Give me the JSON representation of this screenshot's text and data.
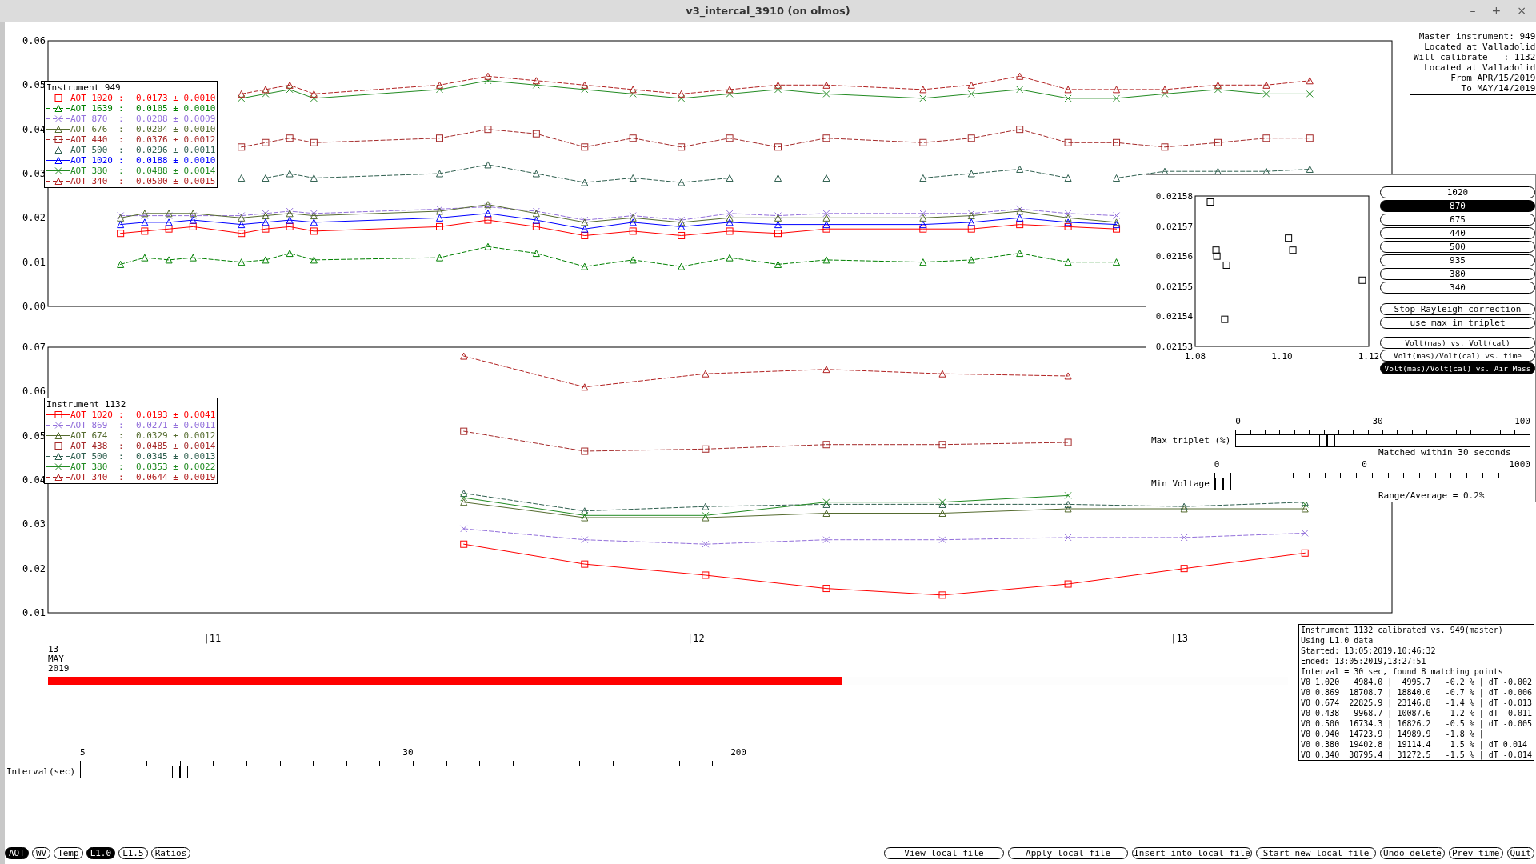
{
  "window": {
    "title": "v3_intercal_3910 (on olmos)",
    "controls": [
      "–",
      "+",
      "×"
    ]
  },
  "master_info": [
    "Master instrument: 949",
    "Located at Valladolid",
    "Will calibrate   : 1132",
    "Located at Valladolid",
    "From APR/15/2019",
    "To MAY/14/2019"
  ],
  "plots": [
    {
      "legend_title": "Instrument 949",
      "legend": [
        {
          "sep": ":",
          "value": "0.0173 ± 0.0010"
        },
        {
          "sep": ":",
          "value": "0.0105 ± 0.0010"
        },
        {
          "sep": ":",
          "value": "0.0208 ± 0.0009"
        },
        {
          "sep": ":",
          "value": "0.0204 ± 0.0010"
        },
        {
          "sep": ":",
          "value": "0.0376 ± 0.0012"
        },
        {
          "sep": ":",
          "value": "0.0296 ± 0.0011"
        },
        {
          "sep": ":",
          "value": "0.0188 ± 0.0010"
        },
        {
          "sep": ":",
          "value": "0.0488 ± 0.0014"
        },
        {
          "sep": ":",
          "value": "0.0500 ± 0.0015"
        }
      ],
      "chart_data": {
        "type": "line",
        "xlim": [
          10.66,
          13.44
        ],
        "ylim": [
          0,
          0.06
        ],
        "yticks": [
          {
            "value": 0,
            "label": "0.00"
          },
          {
            "value": 0.01,
            "label": "0.01"
          },
          {
            "value": 0.02,
            "label": "0.02"
          },
          {
            "value": 0.03,
            "label": "0.03"
          },
          {
            "value": 0.04,
            "label": "0.04"
          },
          {
            "value": 0.05,
            "label": "0.05"
          },
          {
            "value": 0.06,
            "label": "0.06"
          }
        ],
        "x": [
          10.81,
          10.86,
          10.91,
          10.96,
          11.06,
          11.11,
          11.16,
          11.21,
          11.47,
          11.57,
          11.67,
          11.77,
          11.87,
          11.97,
          12.07,
          12.17,
          12.27,
          12.47,
          12.57,
          12.67,
          12.77,
          12.87,
          12.97,
          13.08,
          13.18,
          13.27
        ],
        "series": [
          {
            "name": "AOT 1020",
            "color": "#ff0000",
            "line_style": "solid",
            "marker": "square",
            "values": [
              0.0165,
              0.017,
              0.0175,
              0.018,
              0.0165,
              0.0175,
              0.018,
              0.017,
              0.018,
              0.0195,
              0.018,
              0.016,
              0.017,
              0.016,
              0.017,
              0.0165,
              0.0175,
              0.0175,
              0.0175,
              0.0185,
              0.018,
              0.0175,
              null,
              null,
              null,
              null
            ]
          },
          {
            "name": "AOT 1639",
            "color": "#008000",
            "line_style": "dashed",
            "marker": "triangle",
            "values": [
              0.0095,
              0.011,
              0.0105,
              0.011,
              0.01,
              0.0105,
              0.012,
              0.0105,
              0.011,
              0.0135,
              0.012,
              0.009,
              0.0105,
              0.009,
              0.011,
              0.0095,
              0.0105,
              0.01,
              0.0105,
              0.012,
              0.01,
              0.01,
              null,
              null,
              null,
              null
            ]
          },
          {
            "name": "AOT 870",
            "color": "#9370db",
            "line_style": "dashed",
            "marker": "cross",
            "values": [
              0.0205,
              0.0205,
              0.0205,
              0.0205,
              0.0205,
              0.021,
              0.0215,
              0.021,
              0.022,
              0.0225,
              0.0215,
              0.0195,
              0.0205,
              0.0195,
              0.021,
              0.0205,
              0.021,
              0.021,
              0.021,
              0.022,
              0.021,
              0.0205,
              null,
              null,
              null,
              null
            ]
          },
          {
            "name": "AOT 676",
            "color": "#556b2f",
            "line_style": "solid",
            "marker": "triangle",
            "values": [
              0.02,
              0.021,
              0.021,
              0.021,
              0.02,
              0.0205,
              0.021,
              0.0205,
              0.0215,
              0.023,
              0.021,
              0.019,
              0.02,
              0.019,
              0.02,
              0.02,
              0.02,
              0.02,
              0.0205,
              0.0215,
              0.02,
              0.019,
              null,
              null,
              null,
              null
            ]
          },
          {
            "name": "AOT 440",
            "color": "#a52a2a",
            "line_style": "dashed",
            "marker": "square",
            "values": [
              null,
              null,
              null,
              null,
              0.036,
              0.037,
              0.038,
              0.037,
              0.038,
              0.04,
              0.039,
              0.036,
              0.038,
              0.036,
              0.038,
              0.036,
              0.038,
              0.037,
              0.038,
              0.04,
              0.037,
              0.037,
              0.036,
              0.037,
              0.038,
              0.038
            ]
          },
          {
            "name": "AOT 500",
            "color": "#2f5f4f",
            "line_style": "dashed",
            "marker": "triangle",
            "values": [
              null,
              null,
              null,
              null,
              0.029,
              0.029,
              0.03,
              0.029,
              0.03,
              0.032,
              0.03,
              0.028,
              0.029,
              0.028,
              0.029,
              0.029,
              0.029,
              0.029,
              0.03,
              0.031,
              0.029,
              0.029,
              0.0305,
              0.0305,
              0.0305,
              0.031
            ]
          },
          {
            "name": "AOT 1020",
            "color": "#0000ff",
            "line_style": "solid",
            "marker": "triangle",
            "values": [
              0.0185,
              0.019,
              0.019,
              0.0195,
              0.0185,
              0.019,
              0.0195,
              0.019,
              0.02,
              0.021,
              0.0195,
              0.0175,
              0.019,
              0.018,
              0.019,
              0.0185,
              0.0185,
              0.0185,
              0.019,
              0.02,
              0.019,
              0.0185,
              null,
              null,
              null,
              null
            ]
          },
          {
            "name": "AOT 380",
            "color": "#228b22",
            "line_style": "solid",
            "marker": "cross",
            "values": [
              null,
              null,
              null,
              null,
              0.047,
              0.048,
              0.049,
              0.047,
              0.049,
              0.051,
              0.05,
              0.049,
              0.048,
              0.047,
              0.048,
              0.049,
              0.048,
              0.047,
              0.048,
              0.049,
              0.047,
              0.047,
              0.048,
              0.049,
              0.048,
              0.048
            ]
          },
          {
            "name": "AOT 340",
            "color": "#b22222",
            "line_style": "dashed",
            "marker": "triangle",
            "values": [
              null,
              null,
              null,
              null,
              0.048,
              0.049,
              0.05,
              0.048,
              0.05,
              0.052,
              0.051,
              0.05,
              0.049,
              0.048,
              0.049,
              0.05,
              0.05,
              0.049,
              0.05,
              0.052,
              0.049,
              0.049,
              0.049,
              0.05,
              0.05,
              0.051
            ]
          }
        ]
      }
    },
    {
      "legend_title": "Instrument 1132",
      "legend": [
        {
          "sep": ":",
          "value": "0.0193 ± 0.0041"
        },
        {
          "sep": ":",
          "value": "0.0271 ± 0.0011"
        },
        {
          "sep": ":",
          "value": "0.0329 ± 0.0012"
        },
        {
          "sep": ":",
          "value": "0.0485 ± 0.0014"
        },
        {
          "sep": ":",
          "value": "0.0345 ± 0.0013"
        },
        {
          "sep": ":",
          "value": "0.0353 ± 0.0022"
        },
        {
          "sep": ":",
          "value": "0.0644 ± 0.0019"
        }
      ],
      "chart_data": {
        "type": "line",
        "xlim": [
          10.66,
          13.44
        ],
        "ylim": [
          0.01,
          0.07
        ],
        "xticks": [
          {
            "value": 11,
            "label": "|11"
          },
          {
            "value": 12,
            "label": "|12"
          },
          {
            "value": 13,
            "label": "|13"
          }
        ],
        "yticks": [
          {
            "value": 0.01,
            "label": "0.01"
          },
          {
            "value": 0.02,
            "label": "0.02"
          },
          {
            "value": 0.03,
            "label": "0.03"
          },
          {
            "value": 0.04,
            "label": "0.04"
          },
          {
            "value": 0.05,
            "label": "0.05"
          },
          {
            "value": 0.06,
            "label": "0.06"
          },
          {
            "value": 0.07,
            "label": "0.07"
          }
        ],
        "x": [
          11.52,
          11.77,
          12.02,
          12.27,
          12.51,
          12.77,
          13.01,
          13.26
        ],
        "series": [
          {
            "name": "AOT 1020",
            "color": "#ff0000",
            "line_style": "solid",
            "marker": "square",
            "values": [
              0.0255,
              0.021,
              0.0185,
              0.0155,
              0.014,
              0.0165,
              0.02,
              0.0235
            ]
          },
          {
            "name": "AOT 869",
            "color": "#9370db",
            "line_style": "dashed",
            "marker": "cross",
            "values": [
              0.029,
              0.0265,
              0.0255,
              0.0265,
              0.0265,
              0.027,
              0.027,
              0.028
            ]
          },
          {
            "name": "AOT 674",
            "color": "#556b2f",
            "line_style": "solid",
            "marker": "triangle",
            "values": [
              0.035,
              0.0315,
              0.0315,
              0.0325,
              0.0325,
              0.0335,
              0.0335,
              0.0335
            ]
          },
          {
            "name": "AOT 438",
            "color": "#a52a2a",
            "line_style": "dashed",
            "marker": "square",
            "values": [
              0.051,
              0.0465,
              0.047,
              0.048,
              0.048,
              0.0485,
              null,
              null
            ]
          },
          {
            "name": "AOT 500",
            "color": "#2f5f4f",
            "line_style": "dashed",
            "marker": "triangle",
            "values": [
              0.037,
              0.033,
              0.034,
              0.0345,
              0.0345,
              0.0345,
              0.034,
              0.035
            ]
          },
          {
            "name": "AOT 380",
            "color": "#228b22",
            "line_style": "solid",
            "marker": "cross",
            "values": [
              0.036,
              0.032,
              0.032,
              0.035,
              0.035,
              0.0365,
              null,
              0.0345
            ]
          },
          {
            "name": "AOT 340",
            "color": "#b22222",
            "line_style": "dashed",
            "marker": "triangle",
            "values": [
              0.068,
              0.061,
              0.064,
              0.065,
              0.064,
              0.0635,
              null,
              null
            ]
          }
        ]
      }
    }
  ],
  "date_label": [
    "13",
    "MAY",
    "2019"
  ],
  "progress": {
    "level": 0.64
  },
  "interval_slider": {
    "label": "Interval(sec)",
    "ticks": [
      "5",
      "30",
      "200"
    ],
    "level": 0.14
  },
  "results": [
    "Instrument 1132 calibrated vs. 949(master)",
    "Using L1.0 data",
    "Started: 13:05:2019,10:46:32",
    "Ended: 13:05:2019,13:27:51",
    "Interval = 30 sec, found 8 matching points",
    "V0 1.020   4984.0 |  4995.7 | -0.2 % | dT -0.002",
    "V0 0.869  18708.7 | 18840.0 | -0.7 % | dT -0.006",
    "V0 0.674  22825.9 | 23146.8 | -1.4 % | dT -0.013",
    "V0 0.438   9968.7 | 10087.6 | -1.2 % | dT -0.011",
    "V0 0.500  16734.3 | 16826.2 | -0.5 % | dT -0.005",
    "V0 0.940  14723.9 | 14989.9 | -1.8 % |",
    "V0 0.380  19402.8 | 19114.4 |  1.5 % | dT 0.014",
    "V0 0.340  30795.4 | 31272.5 | -1.5 % | dT -0.014"
  ],
  "popup": {
    "chart_data": {
      "type": "scatter",
      "xlim": [
        1.08,
        1.12
      ],
      "ylim": [
        0.02153,
        0.02158
      ],
      "xticks": [
        {
          "value": 1.08,
          "label": "1.08"
        },
        {
          "value": 1.1,
          "label": "1.10"
        },
        {
          "value": 1.12,
          "label": "1.12"
        }
      ],
      "yticks": [
        {
          "value": 0.02153,
          "label": "0.02153"
        },
        {
          "value": 0.02154,
          "label": "0.02154"
        },
        {
          "value": 0.02155,
          "label": "0.02155"
        },
        {
          "value": 0.02156,
          "label": "0.02156"
        },
        {
          "value": 0.02157,
          "label": "0.02157"
        },
        {
          "value": 0.02158,
          "label": "0.02158"
        }
      ],
      "x": [
        1.0835,
        1.0848,
        1.085,
        1.0872,
        1.0868,
        1.1015,
        1.1025,
        1.1185
      ],
      "series": [
        {
          "color": "#000000",
          "marker": "square",
          "values": [
            0.021578,
            0.021562,
            0.02156,
            0.021557,
            0.021539,
            0.021566,
            0.021562,
            0.021552
          ]
        }
      ]
    },
    "bands": [
      {
        "label": "1020",
        "selected": false
      },
      {
        "label": "870",
        "selected": true
      },
      {
        "label": "675",
        "selected": false
      },
      {
        "label": "440",
        "selected": false
      },
      {
        "label": "500",
        "selected": false
      },
      {
        "label": "935",
        "selected": false
      },
      {
        "label": "380",
        "selected": false
      },
      {
        "label": "340",
        "selected": false
      }
    ],
    "options": [
      "Stop Rayleigh correction",
      "use max in triplet"
    ],
    "modes": [
      {
        "label": "Volt(mas) vs. Volt(cal)",
        "selected": false
      },
      {
        "label": "Volt(mas)/Volt(cal) vs. time",
        "selected": false
      },
      {
        "label": "Volt(mas)/Volt(cal) vs. Air Mass",
        "selected": true
      }
    ],
    "sliders": [
      {
        "label": "Max triplet (%)",
        "ticks": [
          "0",
          "30",
          "100"
        ],
        "level": 0.3,
        "note": "Matched within 30 seconds"
      },
      {
        "label": "Min Voltage",
        "ticks": [
          "0",
          "0",
          "1000"
        ],
        "level": 0.0,
        "note": "Range/Average = 0.2%"
      }
    ]
  },
  "toggles": [
    {
      "label": "AOT",
      "selected": true
    },
    {
      "label": "WV",
      "selected": false
    },
    {
      "label": "Temp",
      "selected": false
    },
    {
      "label": "L1.0",
      "selected": true
    },
    {
      "label": "L1.5",
      "selected": false
    },
    {
      "label": "Ratios",
      "selected": false
    }
  ],
  "actions": [
    "View local file",
    "Apply local file",
    "Insert into local file",
    "Start new local file",
    "Undo delete",
    "Prev time",
    "Quit"
  ]
}
